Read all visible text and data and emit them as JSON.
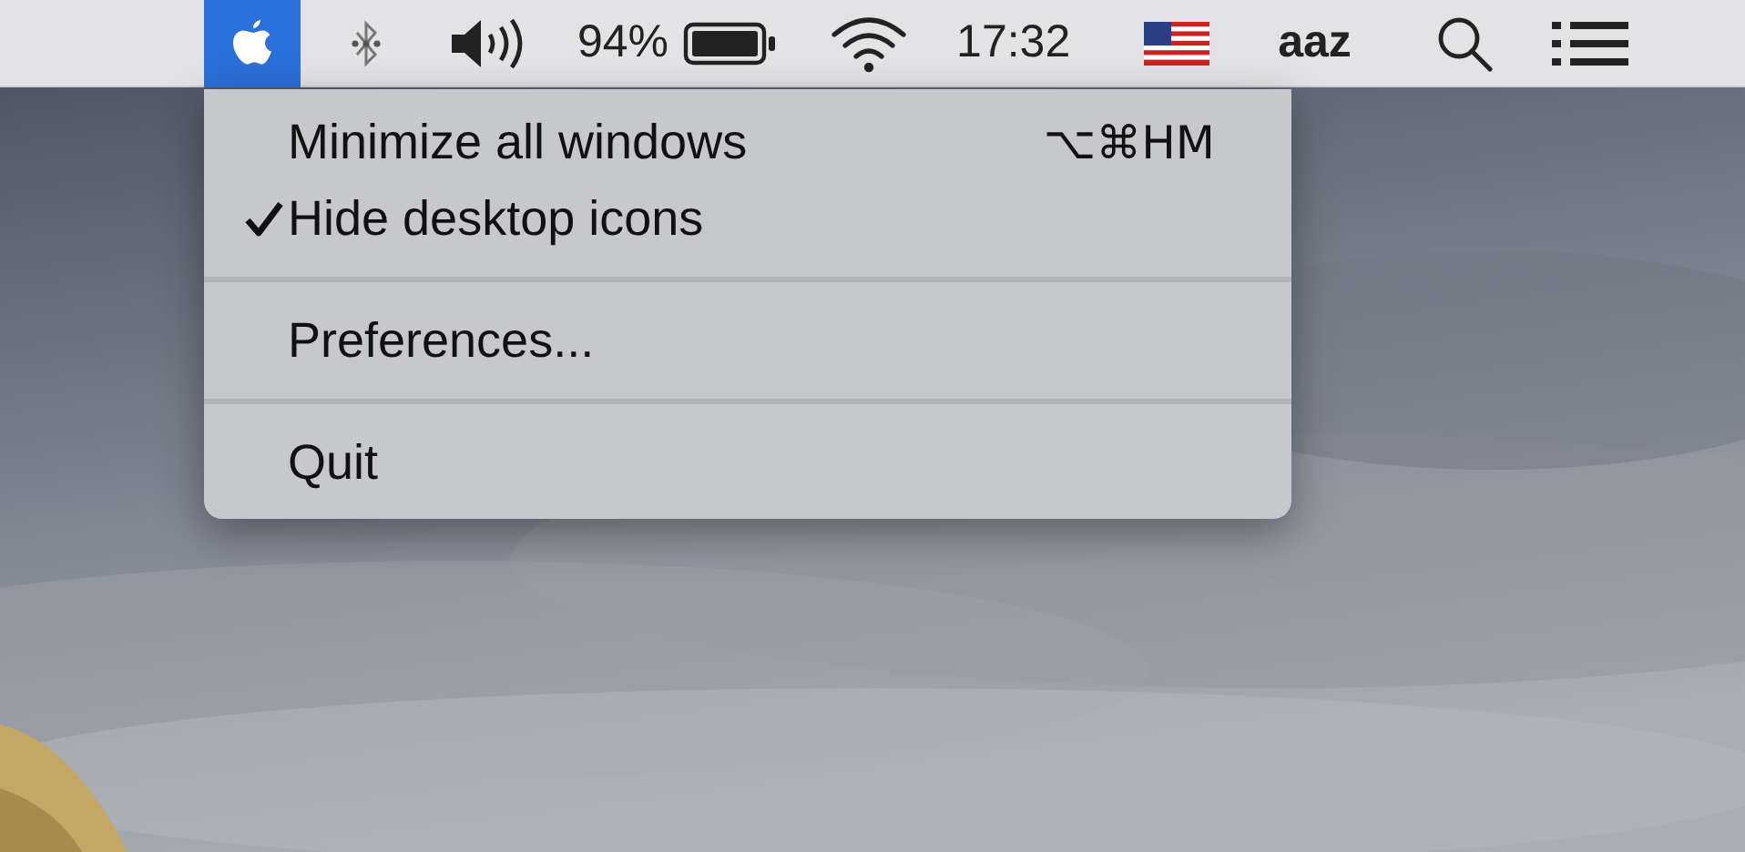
{
  "menu_bar": {
    "apple_menu": {
      "selected": true
    },
    "battery_percent": "94%",
    "clock": "17:32",
    "input_source": "aaz"
  },
  "menu": {
    "items": [
      {
        "kind": "item",
        "label": "Minimize all windows",
        "shortcut": "⌥⌘HM",
        "checked": false
      },
      {
        "kind": "item",
        "label": "Hide desktop icons",
        "checked": true
      },
      {
        "kind": "separator"
      },
      {
        "kind": "item",
        "label": "Preferences...",
        "checked": false
      },
      {
        "kind": "separator"
      },
      {
        "kind": "item",
        "label": "Quit",
        "checked": false
      }
    ]
  }
}
